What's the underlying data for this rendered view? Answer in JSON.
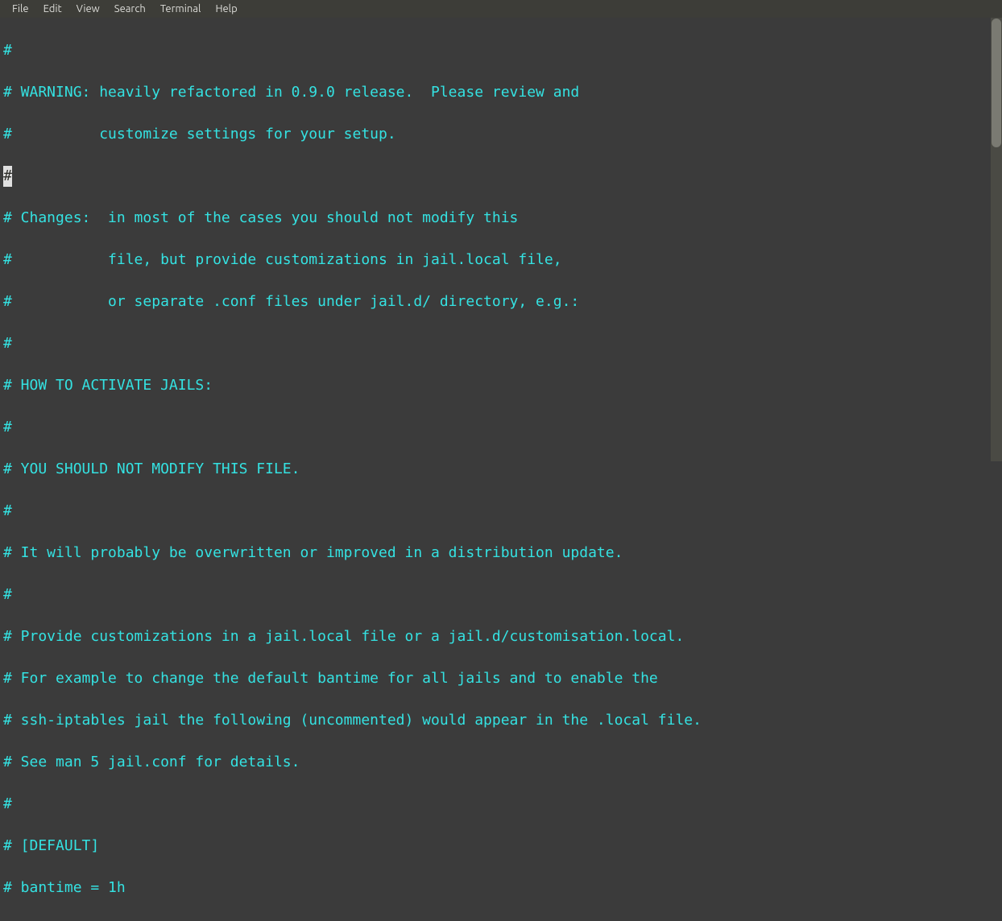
{
  "menubar": {
    "items": [
      {
        "label": "File"
      },
      {
        "label": "Edit"
      },
      {
        "label": "View"
      },
      {
        "label": "Search"
      },
      {
        "label": "Terminal"
      },
      {
        "label": "Help"
      }
    ]
  },
  "editor": {
    "cursor_char": "#",
    "lines": [
      "#",
      "# WARNING: heavily refactored in 0.9.0 release.  Please review and",
      "#          customize settings for your setup.",
      "",
      "# Changes:  in most of the cases you should not modify this",
      "#           file, but provide customizations in jail.local file,",
      "#           or separate .conf files under jail.d/ directory, e.g.:",
      "#",
      "# HOW TO ACTIVATE JAILS:",
      "#",
      "# YOU SHOULD NOT MODIFY THIS FILE.",
      "#",
      "# It will probably be overwritten or improved in a distribution update.",
      "#",
      "# Provide customizations in a jail.local file or a jail.d/customisation.local.",
      "# For example to change the default bantime for all jails and to enable the",
      "# ssh-iptables jail the following (uncommented) would appear in the .local file.",
      "# See man 5 jail.conf for details.",
      "#",
      "# [DEFAULT]",
      "# bantime = 1h"
    ]
  }
}
